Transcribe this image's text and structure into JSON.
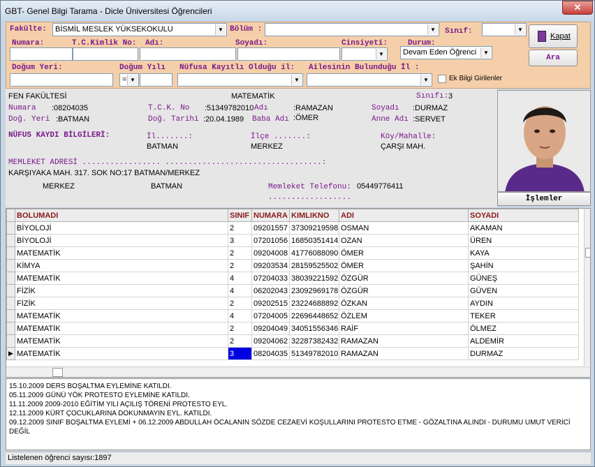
{
  "window": {
    "title": "GBT- Genel Bilgi Tarama - Dicle Üniversitesi Öğrencileri",
    "close_glyph": "✕"
  },
  "filter": {
    "fakulte_label": "Fakülte:",
    "fakulte_value": "BİSMİL MESLEK YÜKSEKOKULU",
    "bolum_label": "Bölüm :",
    "bolum_value": "",
    "sinif_label": "Sınıf:",
    "sinif_value": "",
    "numara_label": "Numara:",
    "numara_value": "",
    "tc_label": "T.C.Kimlik No:",
    "tc_value": "",
    "adi_label": "Adı:",
    "adi_value": "",
    "soyadi_label": "Soyadı:",
    "soyadi_value": "",
    "cinsiyet_label": "Cinsiyeti:",
    "cinsiyet_value": "",
    "durum_label": "Durum:",
    "durum_value": "Devam Eden Öğrenci",
    "dogum_yeri_label": "Doğum Yeri:",
    "dogum_yeri_value": "",
    "dogum_yili_label": "Doğum Yılı",
    "dogum_yili_op": "=",
    "dogum_yili_value": "",
    "nufus_label": "Nüfusa Kayıtlı Olduğu il:",
    "nufus_value": "",
    "aile_label": "Ailesinin Bulunduğu İl :",
    "aile_value": "",
    "ek_bilgi_label": "Ek Bilgi Girilenler",
    "kapat_label": "Kapat",
    "ara_label": "Ara"
  },
  "student": {
    "fakulte": "FEN FAKÜLTESİ",
    "bolum": "MATEMATİK",
    "sinif_label": "Sınıfı:",
    "sinif": "3",
    "numara_label": "Numara",
    "numara": ":08204035",
    "tck_label": "T.C.K. No",
    "tck": ":51349782010",
    "adi_label": "Adı",
    "adi": ":RAMAZAN",
    "soyadi_label": "Soyadı",
    "soyadi": ":DURMAZ",
    "dogum_yeri_label": "Doğ. Yeri",
    "dogum_yeri": ":BATMAN",
    "dogum_tarihi_label": "Doğ. Tarihi",
    "dogum_tarihi": ":20.04.1989",
    "baba_label": "Baba Adı",
    "baba": ":ÖMER",
    "anne_label": "Anne Adı",
    "anne": ":SERVET",
    "nufus_header": "NÜFUS KAYDI BİLGİLERİ:",
    "il_label": "İl.......:",
    "il": "BATMAN",
    "ilce_label": "İlçe .......:",
    "ilce": "MERKEZ",
    "koy_label": "Köy/Mahalle:",
    "koy": "ÇARŞI MAH.",
    "memleket_header": "MEMLEKET ADRESİ  ................. ..................................:",
    "adres": "KARŞIYAKA MAH. 317. SOK NO:17 BATMAN/MERKEZ",
    "adres_ilce": "MERKEZ",
    "adres_il": "BATMAN",
    "tel_label": "Memleket Telefonu:",
    "tel": "05449776411",
    "dots": "..................",
    "islemler_label": "İşlemler"
  },
  "table": {
    "columns": [
      "BOLUMADI",
      "SINIF",
      "NUMARA",
      "KIMLIKNO",
      "ADI",
      "SOYADI"
    ],
    "rows": [
      [
        "BİYOLOJİ",
        "2",
        "09201557",
        "37309219598",
        "OSMAN",
        "AKAMAN"
      ],
      [
        "BİYOLOJİ",
        "3",
        "07201056",
        "16850351414",
        "OZAN",
        "ÜREN"
      ],
      [
        "MATEMATİK",
        "2",
        "09204008",
        "41776088090",
        "ÖMER",
        "KAYA"
      ],
      [
        "KİMYA",
        "2",
        "09203534",
        "28159525502",
        "ÖMER",
        "ŞAHİN"
      ],
      [
        "MATEMATİK",
        "4",
        "07204033",
        "38039221592",
        "ÖZGÜR",
        "GÜNEŞ"
      ],
      [
        "FİZİK",
        "4",
        "06202043",
        "23092969178",
        "ÖZGÜR",
        "GÜVEN"
      ],
      [
        "FİZİK",
        "2",
        "09202515",
        "23224688892",
        "ÖZKAN",
        "AYDIN"
      ],
      [
        "MATEMATİK",
        "4",
        "07204005",
        "22696448652",
        "ÖZLEM",
        "TEKER"
      ],
      [
        "MATEMATİK",
        "2",
        "09204049",
        "34051556346",
        "RAİF",
        "ÖLMEZ"
      ],
      [
        "MATEMATİK",
        "2",
        "09204062",
        "32287382432",
        "RAMAZAN",
        "ALDEMİR"
      ],
      [
        "MATEMATİK",
        "3",
        "08204035",
        "51349782010",
        "RAMAZAN",
        "DURMAZ"
      ]
    ]
  },
  "notes": [
    "15.10.2009 DERS BOŞALTMA EYLEMİNE KATILDI.",
    "05.11.2009 GÜNÜ YÖK PROTESTO EYLEMİNE KATILDI.",
    "11.11.2009 2009-2010 EĞİTİM YILI AÇILIŞ TÖRENİ PROTESTO EYL.",
    "12.11.2009 KÜRT ÇOCUKLARINA DOKUNMAYIN EYL. KATILDI.",
    "09.12.2009 SINIF BOŞALTMA EYLEMİ  + 06.12.2009 ABDULLAH ÖCALANIN SÖZDE CEZAEVİ KOŞULLARINI PROTESTO ETME  -   GÖZALTINA ALINDI - DURUMU UMUT VERİCİ DEĞİL"
  ],
  "status": "Listelenen öğrenci sayısı:1897"
}
